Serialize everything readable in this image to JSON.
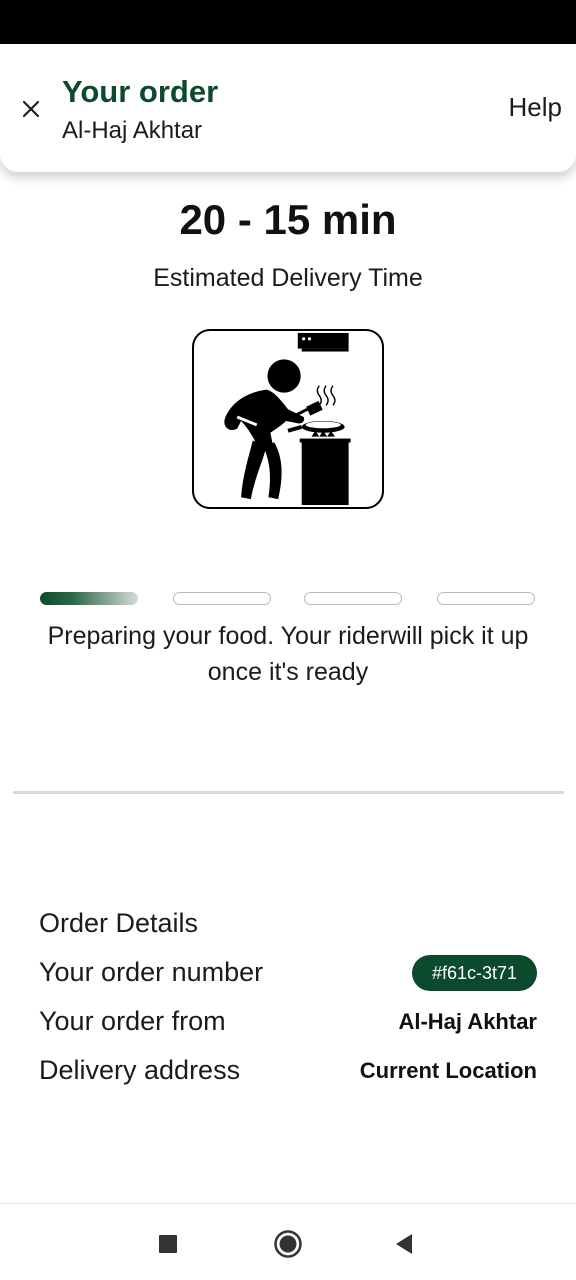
{
  "header": {
    "title": "Your order",
    "subtitle": "Al-Haj Akhtar",
    "help_label": "Help",
    "close_icon": "close-icon"
  },
  "eta": {
    "time": "20 - 15 min",
    "label": "Estimated Delivery Time"
  },
  "illustration": {
    "icon": "chef-cooking-icon"
  },
  "progress": {
    "total_steps": 4,
    "current_step": 1,
    "accent_color": "#0b4a2c"
  },
  "status_message": "Preparing your food.  Your riderwill pick it up once it's ready",
  "details": {
    "heading": "Order Details",
    "order_number_label": "Your order number",
    "order_number": "#f61c-3t71",
    "order_from_label": "Your order from",
    "order_from": "Al-Haj Akhtar",
    "address_label": "Delivery address",
    "address": "Current Location"
  },
  "colors": {
    "brand": "#0b4a2c",
    "status_bar": "#000000"
  },
  "nav": {
    "recents_icon": "square-recents-icon",
    "home_icon": "circle-home-icon",
    "back_icon": "triangle-back-icon"
  }
}
